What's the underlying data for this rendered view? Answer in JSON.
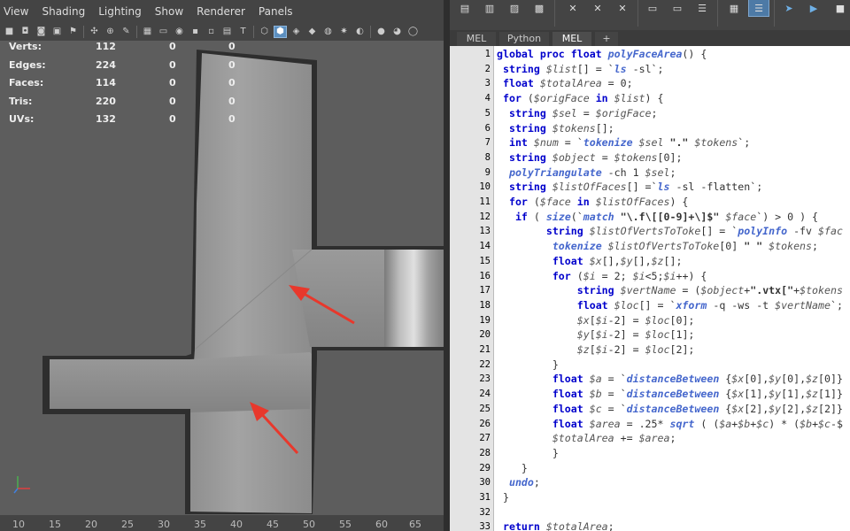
{
  "menu": [
    "View",
    "Shading",
    "Lighting",
    "Show",
    "Renderer",
    "Panels"
  ],
  "hud": [
    {
      "label": "Verts:",
      "values": [
        "112",
        "0",
        "0"
      ]
    },
    {
      "label": "Edges:",
      "values": [
        "224",
        "0",
        "0"
      ]
    },
    {
      "label": "Faces:",
      "values": [
        "114",
        "0",
        "0"
      ]
    },
    {
      "label": "Tris:",
      "values": [
        "220",
        "0",
        "0"
      ]
    },
    {
      "label": "UVs:",
      "values": [
        "132",
        "0",
        "0"
      ]
    }
  ],
  "ruler_ticks": [
    "10",
    "15",
    "20",
    "25",
    "30",
    "35",
    "40",
    "45",
    "50",
    "55",
    "60",
    "65"
  ],
  "tabs": [
    "MEL",
    "Python",
    "MEL",
    "+"
  ],
  "colors": {
    "keyword": "#0000cc",
    "function": "#4466cc",
    "viewport_bg": "#5d5d5d",
    "arrow": "#e8382c",
    "selected": "#5b8fc0"
  },
  "code": [
    {
      "n": "1",
      "t": [
        [
          "kw",
          "global proc float "
        ],
        [
          "fn",
          "polyFaceArea"
        ],
        [
          "tx",
          "() {"
        ]
      ]
    },
    {
      "n": "2",
      "t": [
        [
          "tx",
          " "
        ],
        [
          "kw",
          "string "
        ],
        [
          "var",
          "$list"
        ],
        [
          "tx",
          "[] = `"
        ],
        [
          "fn",
          "ls"
        ],
        [
          "tx",
          " -sl`;"
        ]
      ]
    },
    {
      "n": "3",
      "t": [
        [
          "tx",
          " "
        ],
        [
          "kw",
          "float "
        ],
        [
          "var",
          "$totalArea"
        ],
        [
          "tx",
          " = 0;"
        ]
      ]
    },
    {
      "n": "4",
      "t": [
        [
          "tx",
          " "
        ],
        [
          "kw",
          "for "
        ],
        [
          "tx",
          "("
        ],
        [
          "var",
          "$origFace"
        ],
        [
          "kw",
          " in "
        ],
        [
          "var",
          "$list"
        ],
        [
          "tx",
          ") {"
        ]
      ]
    },
    {
      "n": "5",
      "t": [
        [
          "tx",
          "  "
        ],
        [
          "kw",
          "string "
        ],
        [
          "var",
          "$sel"
        ],
        [
          "tx",
          " = "
        ],
        [
          "var",
          "$origFace"
        ],
        [
          "tx",
          ";"
        ]
      ]
    },
    {
      "n": "6",
      "t": [
        [
          "tx",
          "  "
        ],
        [
          "kw",
          "string "
        ],
        [
          "var",
          "$tokens"
        ],
        [
          "tx",
          "[];"
        ]
      ]
    },
    {
      "n": "7",
      "t": [
        [
          "tx",
          "  "
        ],
        [
          "kw",
          "int "
        ],
        [
          "var",
          "$num"
        ],
        [
          "tx",
          " = `"
        ],
        [
          "fn",
          "tokenize"
        ],
        [
          "var",
          " $sel "
        ],
        [
          "str",
          "\".\""
        ],
        [
          "var",
          " $tokens"
        ],
        [
          "tx",
          "`;"
        ]
      ]
    },
    {
      "n": "8",
      "t": [
        [
          "tx",
          "  "
        ],
        [
          "kw",
          "string "
        ],
        [
          "var",
          "$object"
        ],
        [
          "tx",
          " = "
        ],
        [
          "var",
          "$tokens"
        ],
        [
          "tx",
          "[0];"
        ]
      ]
    },
    {
      "n": "9",
      "t": [
        [
          "tx",
          "  "
        ],
        [
          "fn",
          "polyTriangulate"
        ],
        [
          "tx",
          " -ch 1 "
        ],
        [
          "var",
          "$sel"
        ],
        [
          "tx",
          ";"
        ]
      ]
    },
    {
      "n": "10",
      "t": [
        [
          "tx",
          "  "
        ],
        [
          "kw",
          "string "
        ],
        [
          "var",
          "$listOfFaces"
        ],
        [
          "tx",
          "[] =`"
        ],
        [
          "fn",
          "ls"
        ],
        [
          "tx",
          " -sl -flatten`;"
        ]
      ]
    },
    {
      "n": "11",
      "t": [
        [
          "tx",
          "  "
        ],
        [
          "kw",
          "for "
        ],
        [
          "tx",
          "("
        ],
        [
          "var",
          "$face"
        ],
        [
          "kw",
          " in "
        ],
        [
          "var",
          "$listOfFaces"
        ],
        [
          "tx",
          ") {"
        ]
      ]
    },
    {
      "n": "12",
      "t": [
        [
          "tx",
          "   "
        ],
        [
          "kw",
          "if "
        ],
        [
          "tx",
          "( "
        ],
        [
          "fn",
          "size"
        ],
        [
          "tx",
          "(`"
        ],
        [
          "fn",
          "match"
        ],
        [
          "str",
          " \"\\.f\\[[0-9]+\\]$\""
        ],
        [
          "var",
          " $face"
        ],
        [
          "tx",
          "`) > 0 ) {"
        ]
      ]
    },
    {
      "n": "13",
      "t": [
        [
          "tx",
          "        "
        ],
        [
          "kw",
          "string "
        ],
        [
          "var",
          "$listOfVertsToToke"
        ],
        [
          "tx",
          "[] = `"
        ],
        [
          "fn",
          "polyInfo"
        ],
        [
          "tx",
          " -fv "
        ],
        [
          "var",
          "$fac"
        ]
      ]
    },
    {
      "n": "14",
      "t": [
        [
          "tx",
          "         "
        ],
        [
          "fn",
          "tokenize"
        ],
        [
          "var",
          " $listOfVertsToToke"
        ],
        [
          "tx",
          "[0] "
        ],
        [
          "str",
          "\" \""
        ],
        [
          "var",
          " $tokens"
        ],
        [
          "tx",
          ";"
        ]
      ]
    },
    {
      "n": "15",
      "t": [
        [
          "tx",
          "         "
        ],
        [
          "kw",
          "float "
        ],
        [
          "var",
          "$x"
        ],
        [
          "tx",
          "[],"
        ],
        [
          "var",
          "$y"
        ],
        [
          "tx",
          "[],"
        ],
        [
          "var",
          "$z"
        ],
        [
          "tx",
          "[];"
        ]
      ]
    },
    {
      "n": "16",
      "t": [
        [
          "tx",
          "         "
        ],
        [
          "kw",
          "for "
        ],
        [
          "tx",
          "("
        ],
        [
          "var",
          "$i"
        ],
        [
          "tx",
          " = 2; "
        ],
        [
          "var",
          "$i"
        ],
        [
          "tx",
          "<5;"
        ],
        [
          "var",
          "$i"
        ],
        [
          "tx",
          "++) {"
        ]
      ]
    },
    {
      "n": "17",
      "t": [
        [
          "tx",
          "             "
        ],
        [
          "kw",
          "string "
        ],
        [
          "var",
          "$vertName"
        ],
        [
          "tx",
          " = ("
        ],
        [
          "var",
          "$object"
        ],
        [
          "tx",
          "+"
        ],
        [
          "str",
          "\".vtx[\""
        ],
        [
          "tx",
          "+"
        ],
        [
          "var",
          "$tokens"
        ]
      ]
    },
    {
      "n": "18",
      "t": [
        [
          "tx",
          "             "
        ],
        [
          "kw",
          "float "
        ],
        [
          "var",
          "$loc"
        ],
        [
          "tx",
          "[] = `"
        ],
        [
          "fn",
          "xform"
        ],
        [
          "tx",
          " -q -ws -t "
        ],
        [
          "var",
          "$vertName"
        ],
        [
          "tx",
          "`;"
        ]
      ]
    },
    {
      "n": "19",
      "t": [
        [
          "tx",
          "             "
        ],
        [
          "var",
          "$x"
        ],
        [
          "tx",
          "["
        ],
        [
          "var",
          "$i"
        ],
        [
          "tx",
          "-2] = "
        ],
        [
          "var",
          "$loc"
        ],
        [
          "tx",
          "[0];"
        ]
      ]
    },
    {
      "n": "20",
      "t": [
        [
          "tx",
          "             "
        ],
        [
          "var",
          "$y"
        ],
        [
          "tx",
          "["
        ],
        [
          "var",
          "$i"
        ],
        [
          "tx",
          "-2] = "
        ],
        [
          "var",
          "$loc"
        ],
        [
          "tx",
          "[1];"
        ]
      ]
    },
    {
      "n": "21",
      "t": [
        [
          "tx",
          "             "
        ],
        [
          "var",
          "$z"
        ],
        [
          "tx",
          "["
        ],
        [
          "var",
          "$i"
        ],
        [
          "tx",
          "-2] = "
        ],
        [
          "var",
          "$loc"
        ],
        [
          "tx",
          "[2];"
        ]
      ]
    },
    {
      "n": "22",
      "t": [
        [
          "tx",
          "         }"
        ]
      ]
    },
    {
      "n": "23",
      "t": [
        [
          "tx",
          "         "
        ],
        [
          "kw",
          "float "
        ],
        [
          "var",
          "$a"
        ],
        [
          "tx",
          " = `"
        ],
        [
          "fn",
          "distanceBetween"
        ],
        [
          "tx",
          " {"
        ],
        [
          "var",
          "$x"
        ],
        [
          "tx",
          "[0],"
        ],
        [
          "var",
          "$y"
        ],
        [
          "tx",
          "[0],"
        ],
        [
          "var",
          "$z"
        ],
        [
          "tx",
          "[0]}"
        ]
      ]
    },
    {
      "n": "24",
      "t": [
        [
          "tx",
          "         "
        ],
        [
          "kw",
          "float "
        ],
        [
          "var",
          "$b"
        ],
        [
          "tx",
          " = `"
        ],
        [
          "fn",
          "distanceBetween"
        ],
        [
          "tx",
          " {"
        ],
        [
          "var",
          "$x"
        ],
        [
          "tx",
          "[1],"
        ],
        [
          "var",
          "$y"
        ],
        [
          "tx",
          "[1],"
        ],
        [
          "var",
          "$z"
        ],
        [
          "tx",
          "[1]}"
        ]
      ]
    },
    {
      "n": "25",
      "t": [
        [
          "tx",
          "         "
        ],
        [
          "kw",
          "float "
        ],
        [
          "var",
          "$c"
        ],
        [
          "tx",
          " = `"
        ],
        [
          "fn",
          "distanceBetween"
        ],
        [
          "tx",
          " {"
        ],
        [
          "var",
          "$x"
        ],
        [
          "tx",
          "[2],"
        ],
        [
          "var",
          "$y"
        ],
        [
          "tx",
          "[2],"
        ],
        [
          "var",
          "$z"
        ],
        [
          "tx",
          "[2]}"
        ]
      ]
    },
    {
      "n": "26",
      "t": [
        [
          "tx",
          "         "
        ],
        [
          "kw",
          "float "
        ],
        [
          "var",
          "$area"
        ],
        [
          "tx",
          " = .25* "
        ],
        [
          "fn",
          "sqrt"
        ],
        [
          "tx",
          " ( ("
        ],
        [
          "var",
          "$a"
        ],
        [
          "tx",
          "+"
        ],
        [
          "var",
          "$b"
        ],
        [
          "tx",
          "+"
        ],
        [
          "var",
          "$c"
        ],
        [
          "tx",
          ") * ("
        ],
        [
          "var",
          "$b"
        ],
        [
          "tx",
          "+"
        ],
        [
          "var",
          "$c"
        ],
        [
          "tx",
          "-$"
        ]
      ]
    },
    {
      "n": "27",
      "t": [
        [
          "tx",
          "         "
        ],
        [
          "var",
          "$totalArea"
        ],
        [
          "tx",
          " += "
        ],
        [
          "var",
          "$area"
        ],
        [
          "tx",
          ";"
        ]
      ]
    },
    {
      "n": "28",
      "t": [
        [
          "tx",
          "         }"
        ]
      ]
    },
    {
      "n": "29",
      "t": [
        [
          "tx",
          "    }"
        ]
      ]
    },
    {
      "n": "30",
      "t": [
        [
          "tx",
          "  "
        ],
        [
          "fn",
          "undo"
        ],
        [
          "tx",
          ";"
        ]
      ]
    },
    {
      "n": "31",
      "t": [
        [
          "tx",
          " }"
        ]
      ]
    },
    {
      "n": "32",
      "t": [
        [
          "tx",
          ""
        ]
      ]
    },
    {
      "n": "33",
      "t": [
        [
          "tx",
          " "
        ],
        [
          "kw",
          "return "
        ],
        [
          "var",
          "$totalArea"
        ],
        [
          "tx",
          ";"
        ]
      ]
    }
  ]
}
